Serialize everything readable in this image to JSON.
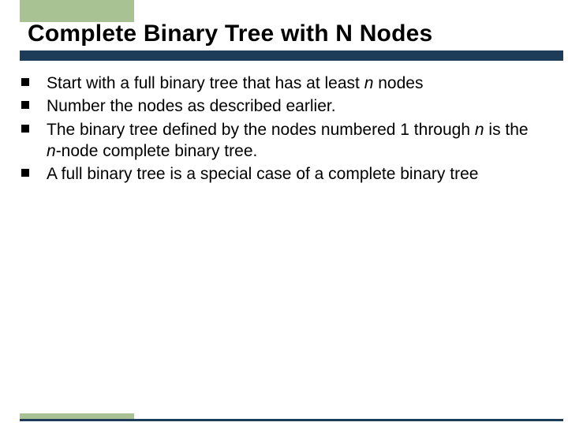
{
  "slide": {
    "title": "Complete Binary Tree with N Nodes",
    "bullets": [
      {
        "pre": "Start with a full binary tree that has at least ",
        "em1": "n",
        "mid": " nodes",
        "em2": "",
        "post": ""
      },
      {
        "pre": "Number the nodes as described earlier.",
        "em1": "",
        "mid": "",
        "em2": "",
        "post": ""
      },
      {
        "pre": "The binary tree defined by the nodes numbered 1 through ",
        "em1": "n",
        "mid": " is the ",
        "em2": "n",
        "post": "-node complete binary tree."
      },
      {
        "pre": "A full binary tree is a special case of a complete binary tree",
        "em1": "",
        "mid": "",
        "em2": "",
        "post": ""
      }
    ]
  }
}
